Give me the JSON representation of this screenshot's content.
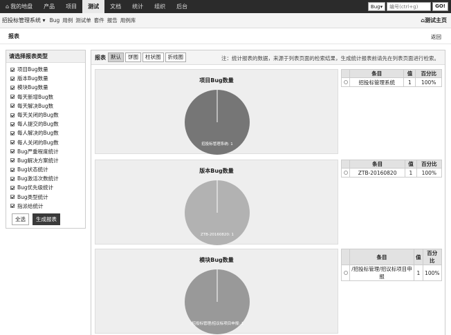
{
  "topnav": {
    "items": [
      "我的地盘",
      "产品",
      "项目",
      "测试",
      "文档",
      "统计",
      "组织",
      "后台"
    ],
    "active_index": 3
  },
  "search": {
    "type": "Bug",
    "placeholder": "编号(ctrl+g)",
    "go": "GO!"
  },
  "subnav": {
    "product": "招投标管理系统",
    "items": [
      "Bug",
      "用例",
      "测试单",
      "套件",
      "报告",
      "用例库"
    ],
    "right": "测试主页"
  },
  "title": {
    "text": "报表",
    "back": "返回"
  },
  "left": {
    "header": "请选择报表类型",
    "items": [
      "项目Bug数量",
      "版本Bug数量",
      "模块Bug数量",
      "每天新增Bug数",
      "每天解决Bug数",
      "每天关闭的Bug数",
      "每人提交的Bug数",
      "每人解决的Bug数",
      "每人关闭的Bug数",
      "Bug严重程度统计",
      "Bug解决方案统计",
      "Bug状态统计",
      "Bug激活次数统计",
      "Bug优先级统计",
      "Bug类型统计",
      "指派给统计"
    ],
    "select_all": "全选",
    "generate": "生成报表"
  },
  "toolbar": {
    "label": "报表",
    "tabs": [
      "默认",
      "饼图",
      "柱状图",
      "折线图"
    ],
    "active_tab": 0,
    "note": "注：统计报表的数据，来源于列表页面的检索结果，生成统计报表前请先在列表页面进行检索。"
  },
  "table_headers": [
    "条目",
    "值",
    "百分比"
  ],
  "reports": [
    {
      "title": "项目Bug数量",
      "slice_label": "招投标管理系统: 1",
      "color": "#767676",
      "rows": [
        {
          "item": "招投标管理系统",
          "value": "1",
          "percent": "100%"
        }
      ]
    },
    {
      "title": "版本Bug数量",
      "slice_label": "ZTB-20160820: 1",
      "color": "#b2b2b2",
      "rows": [
        {
          "item": "ZTB-20160820",
          "value": "1",
          "percent": "100%"
        }
      ]
    },
    {
      "title": "模块Bug数量",
      "slice_label": "/招投标管理/招议标项目申报: 1",
      "color": "#999999",
      "rows": [
        {
          "item": "/招投标管理/招议标项目申报",
          "value": "1",
          "percent": "100%"
        }
      ]
    }
  ]
}
